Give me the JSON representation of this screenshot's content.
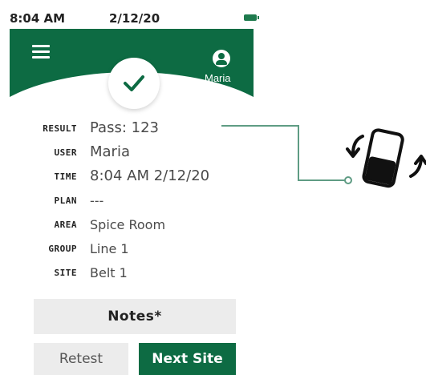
{
  "status_bar": {
    "time": "8:04 AM",
    "date": "2/12/20",
    "battery_icon": "battery-full-icon"
  },
  "header": {
    "menu_icon": "hamburger-menu-icon",
    "user_icon": "user-account-icon",
    "user_name": "Maria",
    "status_icon": "checkmark-icon",
    "color": "#0d6b43"
  },
  "fields": [
    {
      "label": "RESULT",
      "value": "Pass: 123"
    },
    {
      "label": "USER",
      "value": "Maria"
    },
    {
      "label": "TIME",
      "value": "8:04 AM 2/12/20"
    },
    {
      "label": "PLAN",
      "value": "---"
    },
    {
      "label": "AREA",
      "value": "Spice Room"
    },
    {
      "label": "GROUP",
      "value": "Line 1"
    },
    {
      "label": "SITE",
      "value": "Belt 1"
    }
  ],
  "buttons": {
    "notes": "Notes*",
    "retest": "Retest",
    "next_site": "Next Site"
  },
  "callout": {
    "icon": "rotate-device-icon",
    "line_color": "#5f9c84"
  }
}
